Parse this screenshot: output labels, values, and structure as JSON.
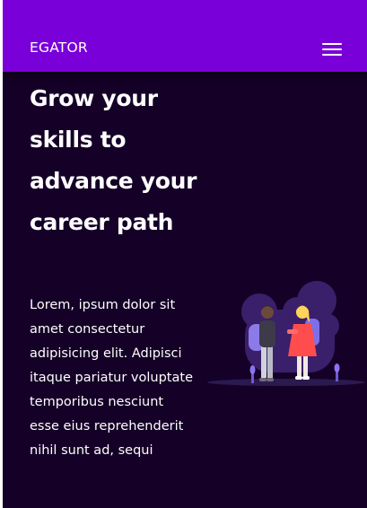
{
  "navbar": {
    "brand": "EGATOR",
    "menu_icon": "hamburger-menu-icon",
    "background": "#7a00d9"
  },
  "hero": {
    "title": "Grow your skills to advance your career path",
    "body": "Lorem, ipsum dolor sit amet consectetur adipisicing elit. Adipisci itaque pariatur voluptate temporibus nesciunt esse eius reprehenderit nihil sunt ad, sequi",
    "background": "#150027",
    "illustration": "two-students-with-backpacks-illustration"
  }
}
